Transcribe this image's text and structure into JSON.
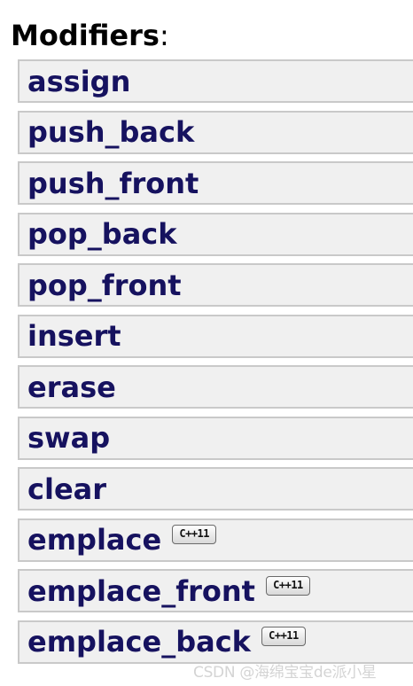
{
  "section": {
    "title": "Modifiers",
    "colon": ":"
  },
  "members": [
    {
      "name": "assign",
      "badge": ""
    },
    {
      "name": "push_back",
      "badge": ""
    },
    {
      "name": "push_front",
      "badge": ""
    },
    {
      "name": "pop_back",
      "badge": ""
    },
    {
      "name": "pop_front",
      "badge": ""
    },
    {
      "name": "insert",
      "badge": ""
    },
    {
      "name": "erase",
      "badge": ""
    },
    {
      "name": "swap",
      "badge": ""
    },
    {
      "name": "clear",
      "badge": ""
    },
    {
      "name": "emplace",
      "badge": "C++11"
    },
    {
      "name": "emplace_front",
      "badge": "C++11"
    },
    {
      "name": "emplace_back",
      "badge": "C++11"
    }
  ],
  "watermark": "CSDN @海绵宝宝de派小星",
  "colors": {
    "link_text": "#16125f",
    "row_background": "#f0f0f0",
    "row_border": "#c9c9c9",
    "watermark": "#d4d4d4"
  }
}
